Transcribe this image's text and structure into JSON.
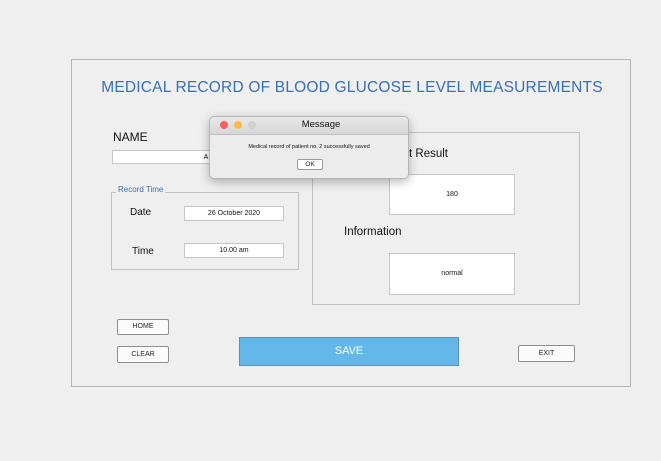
{
  "app": {
    "title": "MEDICAL RECORD OF BLOOD GLUCOSE LEVEL MEASUREMENTS",
    "name_label": "NAME",
    "name_value": "A",
    "record_time": {
      "group_label": "Record Time",
      "date_label": "Date",
      "date_value": "26 October 2020",
      "time_label": "Time",
      "time_value": "10.00 am"
    },
    "result": {
      "result_label": "Test Result",
      "result_label_visible": "t Result",
      "result_value": "180",
      "info_label": "Information",
      "info_value": "normal"
    },
    "buttons": {
      "home": "HOME",
      "clear": "CLEAR",
      "save": "SAVE",
      "exit": "EXIT"
    }
  },
  "dialog": {
    "title": "Message",
    "message": "Medical record of patient no. 2  successfully saved",
    "ok": "OK"
  },
  "colors": {
    "title": "#3a6fb3",
    "save_button": "#64b7e9",
    "close_dot": "#fc605b",
    "minimize_dot": "#fdbc40",
    "zoom_dot_inactive": "#cfcfcf"
  }
}
